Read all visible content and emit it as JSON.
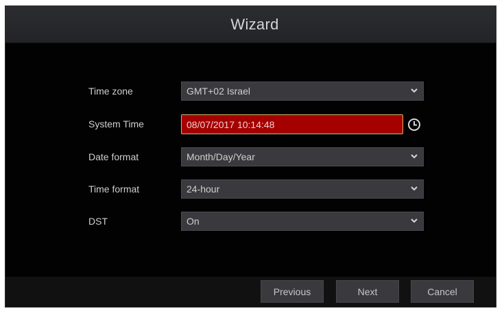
{
  "window": {
    "title": "Wizard"
  },
  "form": {
    "time_zone": {
      "label": "Time zone",
      "value": "GMT+02 Israel"
    },
    "system_time": {
      "label": "System Time",
      "value": "08/07/2017 10:14:48",
      "icon": "clock-icon"
    },
    "date_format": {
      "label": "Date format",
      "value": "Month/Day/Year"
    },
    "time_format": {
      "label": "Time format",
      "value": "24-hour"
    },
    "dst": {
      "label": "DST",
      "value": "On"
    }
  },
  "footer": {
    "previous_label": "Previous",
    "next_label": "Next",
    "cancel_label": "Cancel"
  },
  "colors": {
    "background": "#020202",
    "titlebar": "#2c2d30",
    "field": "#3a3a3e",
    "time_field": "#a50000",
    "time_field_border": "#d9b36a",
    "text": "#cfcfcf"
  }
}
